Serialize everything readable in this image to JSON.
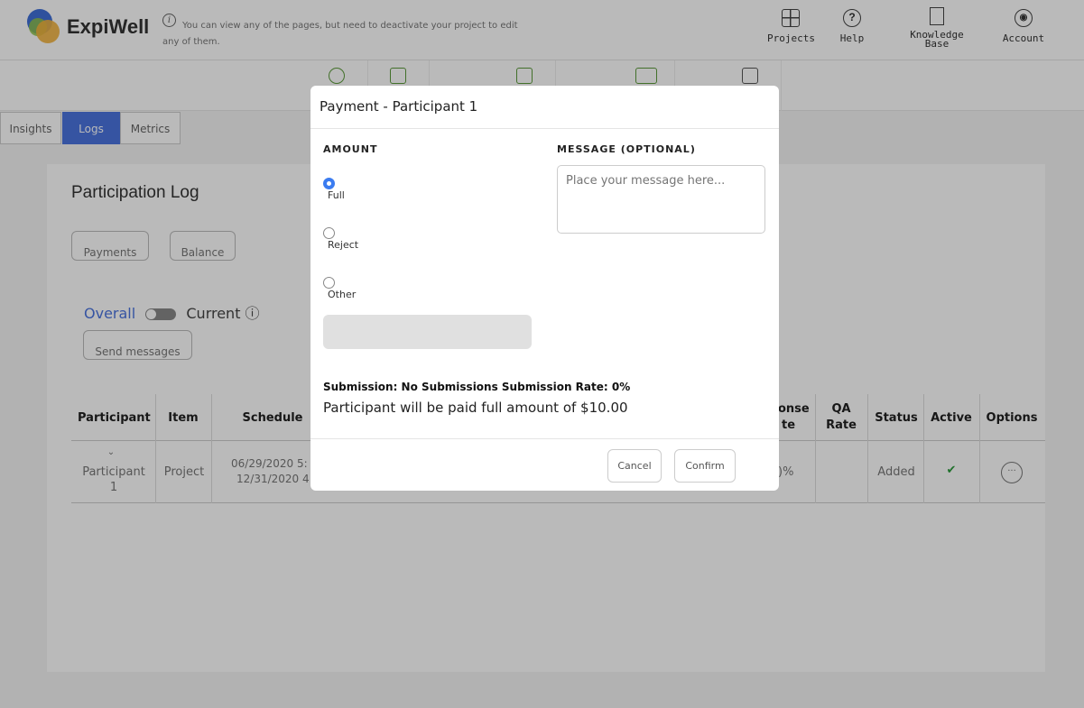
{
  "header": {
    "brand": "ExpiWell",
    "notice_line1": "You can view any of the pages, but need to deactivate your project to edit",
    "notice_line2": "any of them.",
    "nav": [
      {
        "label": "Projects",
        "icon": "grid-icon"
      },
      {
        "label": "Help",
        "icon": "help-icon"
      },
      {
        "label_line1": "Knowledge",
        "label_line2": "Base",
        "icon": "book-icon"
      },
      {
        "label": "Account",
        "icon": "account-icon"
      }
    ]
  },
  "tabs": [
    "Insights",
    "Logs",
    "Metrics"
  ],
  "card": {
    "title": "Participation Log",
    "payments_button": "Payments",
    "balance_button": "Balance",
    "overall": "Overall",
    "current": "Current ⓘ",
    "send_messages": "Send messages"
  },
  "table": {
    "headers": {
      "participant": "Participant",
      "item": "Item",
      "schedule": "Schedule",
      "response_rate_part": "onse",
      "response_rate_part2": "te",
      "qa_rate_1": "QA",
      "qa_rate_2": "Rate",
      "status": "Status",
      "active": "Active",
      "options": "Options"
    },
    "row": {
      "participant_1": "Participant",
      "participant_2": "1",
      "item": "Project",
      "schedule_1": "06/29/2020 5:",
      "schedule_2": "12/31/2020 4:",
      "response_rate": ")%",
      "status": "Added",
      "active": "✔",
      "options": "···"
    }
  },
  "modal": {
    "title": "Payment - Participant 1",
    "amount_label": "AMOUNT",
    "message_label": "MESSAGE (OPTIONAL)",
    "options": [
      "Full",
      "Reject",
      "Other"
    ],
    "message_placeholder": "Place your message here...",
    "submission_line": "Submission: No Submissions Submission Rate: 0%",
    "paid_line": "Participant will be paid full amount of $10.00",
    "cancel": "Cancel",
    "confirm": "Confirm"
  },
  "colors": {
    "accent": "#4a73df",
    "radio_checked": "#3b7cf0",
    "active_check": "#2a9a3a"
  }
}
